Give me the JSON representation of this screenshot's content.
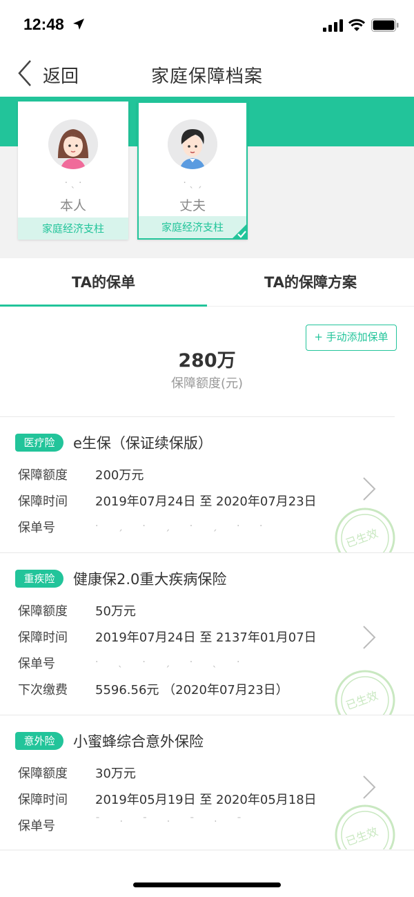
{
  "status": {
    "time": "12:48"
  },
  "nav": {
    "back_label": "返回",
    "title": "家庭保障档案"
  },
  "members": [
    {
      "role": "本人",
      "tag": "家庭经济支柱",
      "selected": false
    },
    {
      "role": "丈夫",
      "tag": "家庭经济支柱",
      "selected": true
    }
  ],
  "tabs": [
    {
      "label": "TA的保单",
      "active": true
    },
    {
      "label": "TA的保障方案",
      "active": false
    }
  ],
  "summary": {
    "add_button": "+ 手动添加保单",
    "total_amount": "280万",
    "total_label": "保障额度(元)"
  },
  "policies": [
    {
      "tag": "医疗险",
      "name": "e生保（保证续保版）",
      "rows": [
        {
          "label": "保障额度",
          "value": "200万元"
        },
        {
          "label": "保障时间",
          "value": "2019年07月24日  至  2020年07月23日"
        },
        {
          "label": "保单号",
          "value": ""
        }
      ],
      "stamp": "已生效"
    },
    {
      "tag": "重疾险",
      "name": "健康保2.0重大疾病保险",
      "rows": [
        {
          "label": "保障额度",
          "value": "50万元"
        },
        {
          "label": "保障时间",
          "value": "2019年07月24日  至  2137年01月07日"
        },
        {
          "label": "保单号",
          "value": ""
        },
        {
          "label": "下次缴费",
          "value": "5596.56元  （2020年07月23日）"
        }
      ],
      "stamp": "已生效"
    },
    {
      "tag": "意外险",
      "name": "小蜜蜂综合意外保险",
      "rows": [
        {
          "label": "保障额度",
          "value": "30万元"
        },
        {
          "label": "保障时间",
          "value": "2019年05月19日  至  2020年05月18日"
        },
        {
          "label": "保单号",
          "value": ""
        }
      ],
      "stamp": "已生效"
    }
  ],
  "colors": {
    "accent": "#22c49a",
    "accent_light": "#d8f4ec",
    "stamp": "#c9e8c1"
  },
  "icons": [
    "location-arrow-icon",
    "signal-icon",
    "wifi-icon",
    "battery-icon",
    "back-chevron-icon",
    "check-icon",
    "chevron-right-icon"
  ]
}
